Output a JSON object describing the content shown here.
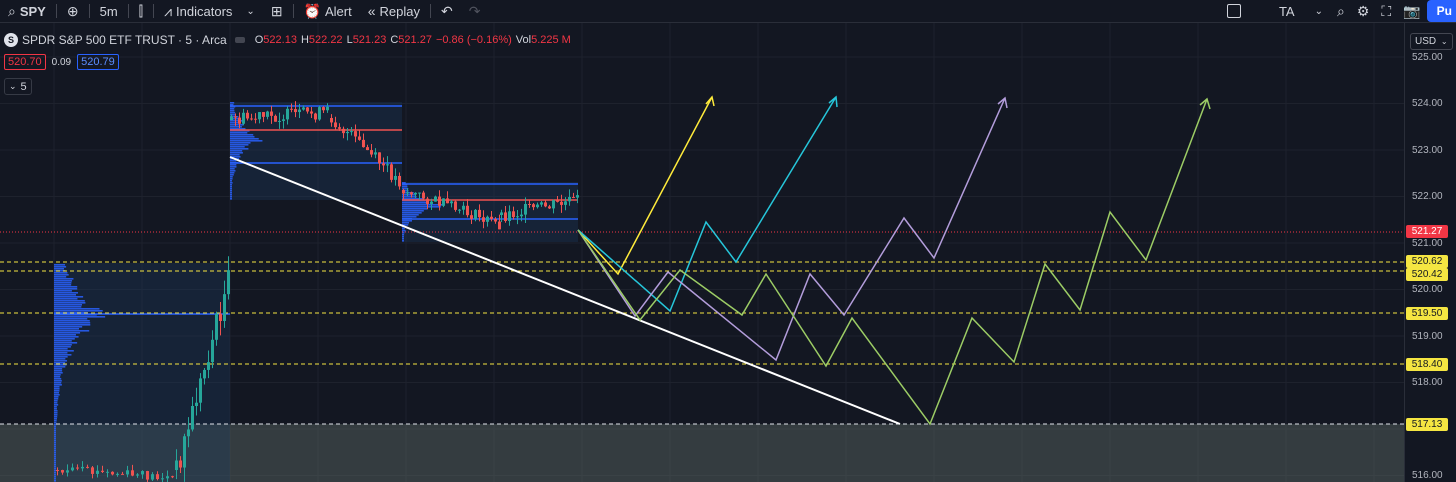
{
  "toolbar": {
    "symbol": "SPY",
    "interval": "5m",
    "indicators_label": "Indicators",
    "alert_label": "Alert",
    "replay_label": "Replay",
    "ta_label": "TA",
    "publish_label": "Pu"
  },
  "legend": {
    "title": "SPDR S&P 500 ETF TRUST · 5 · Arca",
    "o_label": "O",
    "o": "522.13",
    "h_label": "H",
    "h": "522.22",
    "l_label": "L",
    "l": "521.23",
    "c_label": "C",
    "c": "521.27",
    "change": "−0.86 (−0.16%)",
    "vol_label": "Vol",
    "vol": "5.225 M",
    "symbol_badge": "S"
  },
  "quote": {
    "bid": "520.70",
    "spread": "0.09",
    "ask": "520.79"
  },
  "collapse_count": "5",
  "currency": "USD",
  "price_axis": {
    "ticks": [
      "525.00",
      "524.00",
      "523.00",
      "522.00",
      "521.00",
      "520.00",
      "519.00",
      "518.00",
      "516.00"
    ],
    "current_price": "521.27",
    "levels": [
      "520.62",
      "520.42",
      "519.50",
      "518.40",
      "517.13"
    ]
  },
  "colors": {
    "background": "#131722",
    "up": "#26a69a",
    "down": "#ef5350",
    "level_line": "#f5e642",
    "current_line": "#f23645",
    "profile": "#2962ff",
    "arrow_yellow": "#ffeb3b",
    "arrow_cyan": "#26c6da",
    "arrow_purple": "#b39ddb",
    "arrow_green": "#9ccc65"
  }
}
